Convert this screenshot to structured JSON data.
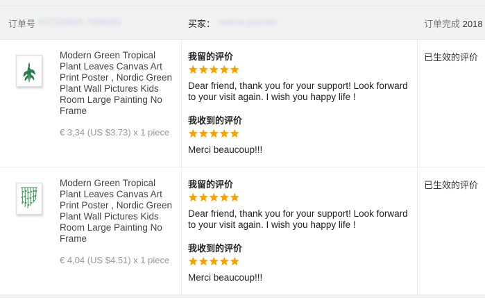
{
  "header": {
    "order_no_label": "订单号",
    "order_no_value": "507229925 7099585",
    "buyer_label": "买家：",
    "buyer_value": "valerie.journier",
    "status_label": "订单完成",
    "status_date": "2018"
  },
  "orders": [
    {
      "product_title": "Modern Green Tropical Plant Leaves Canvas Art Print Poster , Nordic Green Plant Wall Pictures Kids Room Large Painting No Frame",
      "price": "€ 3,34 (US $3.73) x 1 piece",
      "my_feedback_heading": "我留的评价",
      "my_rating": 5,
      "my_feedback_text": "Dear friend, thank you for your support! Look forward to your visit again. I wish you happy life !",
      "received_feedback_heading": "我收到的评价",
      "received_rating": 5,
      "received_feedback_text": "Merci beaucoup!!!",
      "status": "已生效的评价",
      "thumbnail_icon": "tropical-leaf-poster-icon"
    },
    {
      "product_title": "Modern Green Tropical Plant Leaves Canvas Art Print Poster , Nordic Green Plant Wall Pictures Kids Room Large Painting No Frame",
      "price": "€ 4,04 (US $4.51) x 1 piece",
      "my_feedback_heading": "我留的评价",
      "my_rating": 5,
      "my_feedback_text": "Dear friend, thank you for your support! Look forward to your visit again. I wish you happy life !",
      "received_feedback_heading": "我收到的评价",
      "received_rating": 5,
      "received_feedback_text": "Merci beaucoup!!!",
      "status": "已生效的评价",
      "thumbnail_icon": "hanging-plant-poster-icon"
    }
  ],
  "colors": {
    "star": "#f5a300",
    "header_bg": "#f2f2f2",
    "leaf_green": "#2e7d4f"
  }
}
